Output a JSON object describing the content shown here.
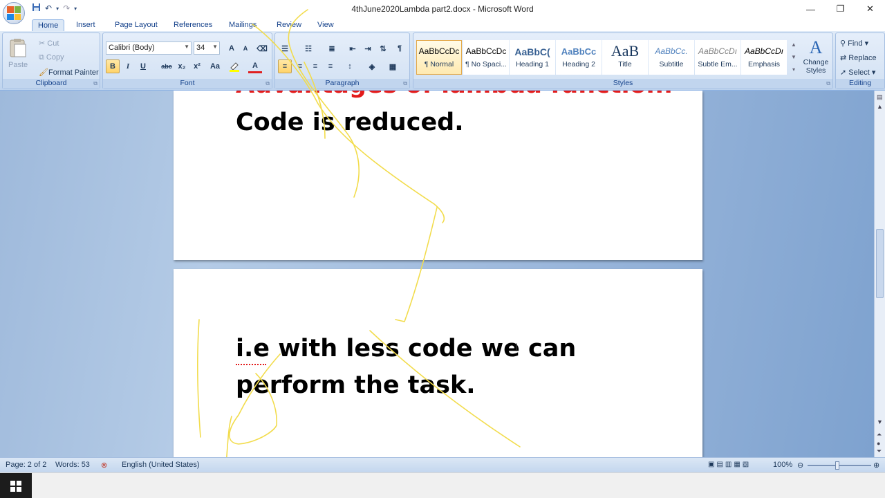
{
  "window": {
    "title": "4thJune2020Lambda part2.docx - Microsoft Word",
    "minimize_glyph": "—",
    "restore_glyph": "❐",
    "close_glyph": "✕"
  },
  "tabs": [
    "Home",
    "Insert",
    "Page Layout",
    "References",
    "Mailings",
    "Review",
    "View"
  ],
  "clipboard": {
    "paste": "Paste",
    "cut": "Cut",
    "copy": "Copy",
    "format_painter": "Format Painter",
    "label": "Clipboard"
  },
  "font": {
    "name": "Calibri (Body)",
    "size": "34",
    "label": "Font",
    "bold": "B",
    "italic": "I",
    "underline": "U",
    "strike": "abc",
    "subscript": "x₂",
    "superscript": "x²",
    "change_case": "Aa",
    "grow": "A",
    "shrink": "A",
    "color": "A"
  },
  "paragraph": {
    "label": "Paragraph"
  },
  "styles": {
    "label": "Styles",
    "items": [
      {
        "sample": "AaBbCcDc",
        "name": "¶ Normal"
      },
      {
        "sample": "AaBbCcDc",
        "name": "¶ No Spaci..."
      },
      {
        "sample": "AaBbC(",
        "name": "Heading 1"
      },
      {
        "sample": "AaBbCc",
        "name": "Heading 2"
      },
      {
        "sample": "AaB",
        "name": "Title"
      },
      {
        "sample": "AaBbCc.",
        "name": "Subtitle"
      },
      {
        "sample": "AaBbCcDı",
        "name": "Subtle Em..."
      },
      {
        "sample": "AaBbCcDı",
        "name": "Emphasis"
      }
    ],
    "change_styles": "Change Styles"
  },
  "editing": {
    "label": "Editing",
    "find": "Find",
    "replace": "Replace",
    "select": "Select"
  },
  "document": {
    "heading_partial": "Advantages of lambda function:",
    "line1": "Code is reduced.",
    "line2": "i.e with less code we can",
    "line3": "perform the task."
  },
  "status": {
    "page": "Page: 2 of 2",
    "words": "Words: 53",
    "language": "English (United States)",
    "zoom": "100%",
    "zoom_level": 1.0
  },
  "colors": {
    "accent": "#15428b",
    "heading_red": "#e31b1b",
    "ink": "#f2dc4c"
  }
}
